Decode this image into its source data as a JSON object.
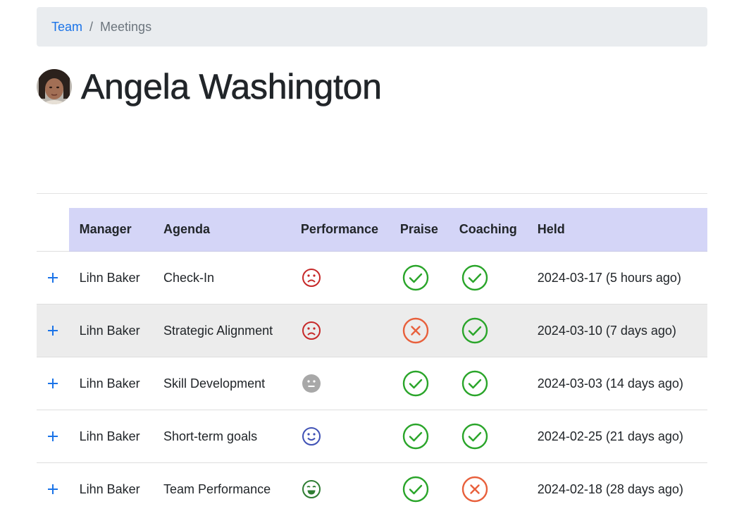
{
  "breadcrumb": {
    "team": "Team",
    "separator": "/",
    "current": "Meetings"
  },
  "person": {
    "name": "Angela Washington",
    "avatar_icon": "user-avatar-photo"
  },
  "table": {
    "headers": {
      "manager": "Manager",
      "agenda": "Agenda",
      "performance": "Performance",
      "praise": "Praise",
      "coaching": "Coaching",
      "held": "Held"
    },
    "rows": [
      {
        "manager": "Lihn Baker",
        "agenda": "Check-In",
        "performance": "sad",
        "praise": "yes",
        "coaching": "yes",
        "held": "2024-03-17 (5 hours ago)"
      },
      {
        "manager": "Lihn Baker",
        "agenda": "Strategic Alignment",
        "performance": "sad",
        "praise": "no",
        "coaching": "yes",
        "held": "2024-03-10 (7 days ago)"
      },
      {
        "manager": "Lihn Baker",
        "agenda": "Skill Development",
        "performance": "neutral",
        "praise": "yes",
        "coaching": "yes",
        "held": "2024-03-03 (14 days ago)"
      },
      {
        "manager": "Lihn Baker",
        "agenda": "Short-term goals",
        "performance": "happy",
        "praise": "yes",
        "coaching": "yes",
        "held": "2024-02-25 (21 days ago)"
      },
      {
        "manager": "Lihn Baker",
        "agenda": "Team Performance",
        "performance": "very-happy",
        "praise": "yes",
        "coaching": "no",
        "held": "2024-02-18 (28 days ago)"
      }
    ]
  },
  "colors": {
    "link": "#1a73e8",
    "header_bg": "#d4d5f7",
    "sad": "#c62828",
    "neutral": "#9e9e9e",
    "happy": "#3f51b5",
    "very_happy": "#2e7d32",
    "yes": "#2aa52a",
    "no": "#e8603c"
  }
}
